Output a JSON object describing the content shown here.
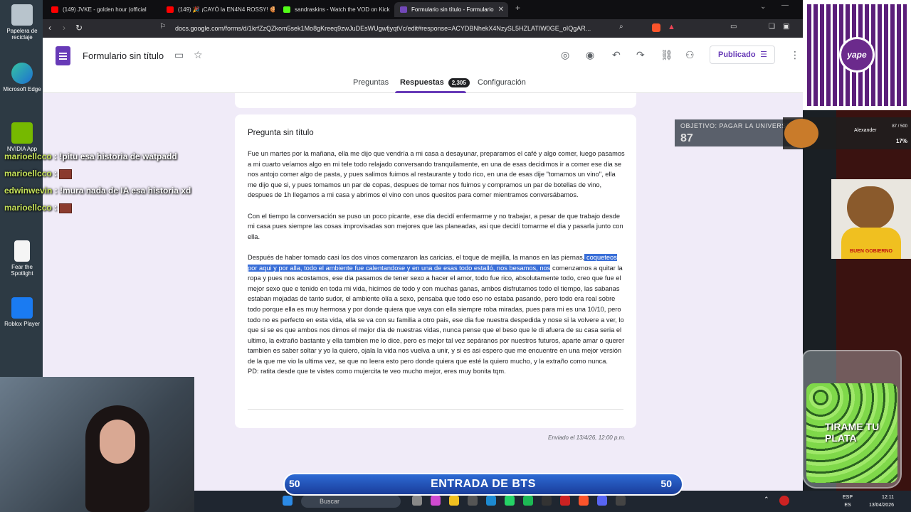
{
  "desktop": {
    "icons": [
      {
        "label": "Papelera de\nreciclaje",
        "icon": "recycle-bin-icon"
      },
      {
        "label": "Microsoft Edge",
        "icon": "edge-icon"
      },
      {
        "label": "NVIDIA App",
        "icon": "nvidia-icon"
      },
      {
        "label": "Fear the\nSpotlight",
        "icon": "file-icon"
      },
      {
        "label": "Roblox Player",
        "icon": "roblox-icon"
      }
    ]
  },
  "browser": {
    "tabs": [
      {
        "title": "(149) JVKE - golden hour (official",
        "color": "#ff0000"
      },
      {
        "title": "(149) 🎉 ¡CAYÓ la EN4N4 ROSSY! 🍪",
        "color": "#ff0000"
      },
      {
        "title": "sandraskins - Watch the VOD on Kick",
        "color": "#53fc18"
      },
      {
        "title": "Formulario sin título - Formulario",
        "color": "#7248b9"
      }
    ],
    "url": "docs.google.com/forms/d/1krfZzQZkom5sek1Mo8gKreeq9zwJuDEsWUgwfjyqtVc/edit#response=ACYDBNhekX4NzySL5HZLATIW0GE_oIQgAR..."
  },
  "form": {
    "title": "Formulario sin título",
    "publish_label": "Publicado",
    "tabs": {
      "questions": "Preguntas",
      "responses": "Respuestas",
      "responses_count": "2,305",
      "settings": "Configuración"
    },
    "question_title": "Pregunta sin título",
    "answer": {
      "p1": "Fue un martes por la mañana, ella me dijo que vendría a mi casa a desayunar, preparamos el café y algo comer, luego pasamos a mi cuarto veíamos algo en mi tele todo relajado conversando tranquilamente, en una de esas decidimos ir a comer ese dia se nos antojo comer algo de pasta, y pues salimos fuimos al restaurante y todo rico, en una de esas dije \"tomamos un vino\", ella me dijo que si, y pues tomamos un par de copas, despues de tomar nos fuimos y compramos un par de botellas de vino, despues de 1h llegamos a mi casa y abrimos el vino con unos quesitos para comer mientramos conversábamos.",
      "p2": "Con el tiempo la conversación se puso un poco picante, ese dia decidí enfermarme y no trabajar, a pesar de que trabajo desde mi casa pues siempre las cosas improvisadas son mejores que las planeadas, asi que decidí tomarme el dia y pasarla junto con ella.",
      "p3_start": "Después de haber tomado casi los dos vinos comenzaron las caricias, el toque de mejilla, la manos en las piernas,",
      "p3_highlight": " coqueteos por aqui y por alla, todo el ambiente fue calentandose y en una de esas todo estalló, nos besamos, nos",
      "p3_end": " comenzamos a quitar la ropa y pues nos acostamos, ese dia pasamos de tener sexo a hacer el amor, todo fue rico, absolutamente todo, creo que fue el mejor sexo que e tenido en toda mi vida, hicimos de todo y con muchas ganas, ambos disfrutamos todo el tiempo, las sabanas estaban mojadas de tanto sudor, el ambiente olía a sexo, pensaba que todo eso no estaba pasando, pero todo era real sobre todo porque ella es muy hermosa y por donde quiera que vaya con ella siempre roba miradas, pues para mi es una 10/10,  pero todo no es perfecto en esta vida, ella se va con su familia a otro pais, ese dia fue nuestra despedida y nose si la volvere a ver, lo que si se es que ambos nos dimos el mejor dia de nuestras vidas, nunca pense que el beso que le di afuera de su casa seria el ultimo, la extraño bastante y ella tambien me lo dice, pero es mejor tal vez sepáranos por nuestros futuros, aparte amar o querer tambien es saber soltar y yo la quiero, ojala la vida nos vuelva a unir, y si es asi espero que me encuentre en una mejor versión de la que me vio la ultima vez, se que no leera esto pero donde quiera que esté la quiero mucho, y la extraño como nunca.",
      "p3_ps": "PD: ratita desde que te vistes como mujercita te veo mucho mejor, eres muy bonita tqm."
    },
    "sent": "Enviado el 13/4/26, 12:00 p.m."
  },
  "chat": [
    {
      "user": "marioellcco",
      "msg": " : !pitu esa historia de watpadd",
      "emote": false
    },
    {
      "user": "marioellcco",
      "msg": " : ",
      "emote": true
    },
    {
      "user": "edwinwevin",
      "msg": " : !mura nada de IA esa historia xd",
      "emote": false
    },
    {
      "user": "marioellcco",
      "msg": " : ",
      "emote": true
    }
  ],
  "goal": {
    "label": "OBJETIVO: PAGAR LA UNIVERSIDAD",
    "value": "87"
  },
  "donor": {
    "name": "Alexander",
    "count": "87 / 500",
    "pct": "17%"
  },
  "qr": {
    "brand": "yape"
  },
  "dog": {
    "slogan": "BUEN GOBIERNO"
  },
  "jar": {
    "text": "TIRAME TU PLATA"
  },
  "banner": {
    "left": "50",
    "center": "ENTRADA DE BTS",
    "right": "50"
  },
  "taskbar": {
    "search": "Buscar",
    "lang": "ESP\nES",
    "time": "12:11",
    "date": "13/04/2026"
  }
}
